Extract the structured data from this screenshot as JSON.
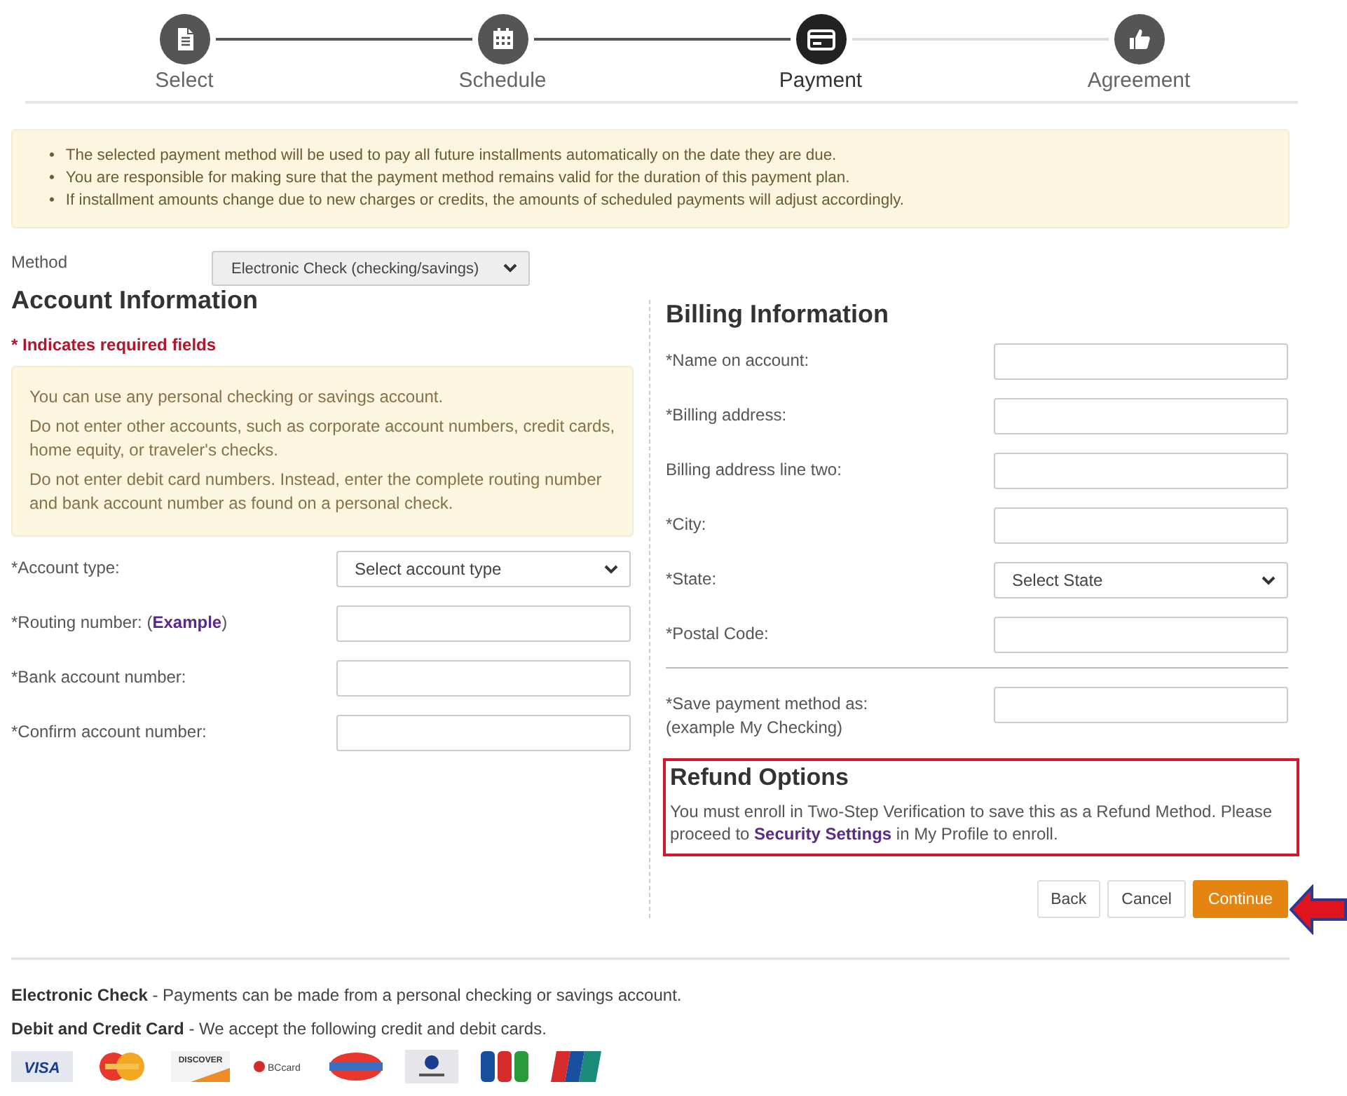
{
  "steps": [
    {
      "label": "Select",
      "selected": false
    },
    {
      "label": "Schedule",
      "selected": false
    },
    {
      "label": "Payment",
      "selected": true
    },
    {
      "label": "Agreement",
      "selected": false
    }
  ],
  "notice": [
    {
      "marker": "•",
      "text": "The selected payment method will be used to pay all future installments automatically on the date they are due."
    },
    {
      "marker": "•",
      "text": "You are responsible for making sure that the payment method remains valid for the duration of this payment plan."
    },
    {
      "marker": "•",
      "text": "If installment amounts change due to new charges or credits, the amounts of scheduled payments will adjust accordingly."
    }
  ],
  "method": {
    "label": "Method",
    "value": "Electronic Check (checking/savings)"
  },
  "account": {
    "title": "Account Information",
    "required_note": "* Indicates required fields",
    "info": [
      "You can use any personal checking or savings account.",
      "Do not enter other accounts, such as corporate account numbers, credit cards, home equity, or traveler's checks.",
      "Do not enter debit card numbers. Instead, enter the complete routing number and bank account number as found on a personal check."
    ],
    "fields": [
      {
        "label": "*Account type:",
        "kind": "select",
        "value": "Select account type"
      },
      {
        "label": "*Routing number: (**Example**)",
        "kind": "text"
      },
      {
        "label": "*Bank account number:",
        "kind": "text"
      },
      {
        "label": "*Confirm account number:",
        "kind": "text"
      }
    ]
  },
  "billing": {
    "title": "Billing Information",
    "fields": [
      {
        "label": "*Name on account:",
        "kind": "text"
      },
      {
        "label": "*Billing address:",
        "kind": "text"
      },
      {
        "label": "Billing address line two:",
        "kind": "text"
      },
      {
        "label": "*City:",
        "kind": "text"
      },
      {
        "label": "*State:",
        "kind": "select",
        "value": "Select State"
      },
      {
        "label": "*Postal Code:",
        "kind": "text"
      },
      {
        "label": "*Save payment method as:",
        "sublabel": "(example My Checking)",
        "kind": "text",
        "divider_before": true
      }
    ]
  },
  "refund": {
    "title": "Refund Options",
    "text": "You must enroll in Two-Step Verification to save this as a Refund Method. Please proceed to **Security Settings** in My Profile to enroll.",
    "highlighted": true
  },
  "buttons": [
    {
      "label": "Back",
      "kind": "default"
    },
    {
      "label": "Cancel",
      "kind": "default"
    },
    {
      "label": "Continue",
      "kind": "primary"
    }
  ],
  "footer": [
    "**Electronic Check** - Payments can be made from a personal checking or savings account.",
    "**Debit and Credit Card** - We accept the following credit and debit cards."
  ],
  "cards": [
    {
      "kind": "visa",
      "text": "VISA"
    },
    {
      "kind": "mastercard"
    },
    {
      "kind": "discover",
      "text": "DISCOVER"
    },
    {
      "kind": "bccard",
      "text": "BCcard"
    },
    {
      "kind": "diners"
    },
    {
      "kind": "dinersclub"
    },
    {
      "kind": "jcb"
    },
    {
      "kind": "unionpay"
    }
  ]
}
